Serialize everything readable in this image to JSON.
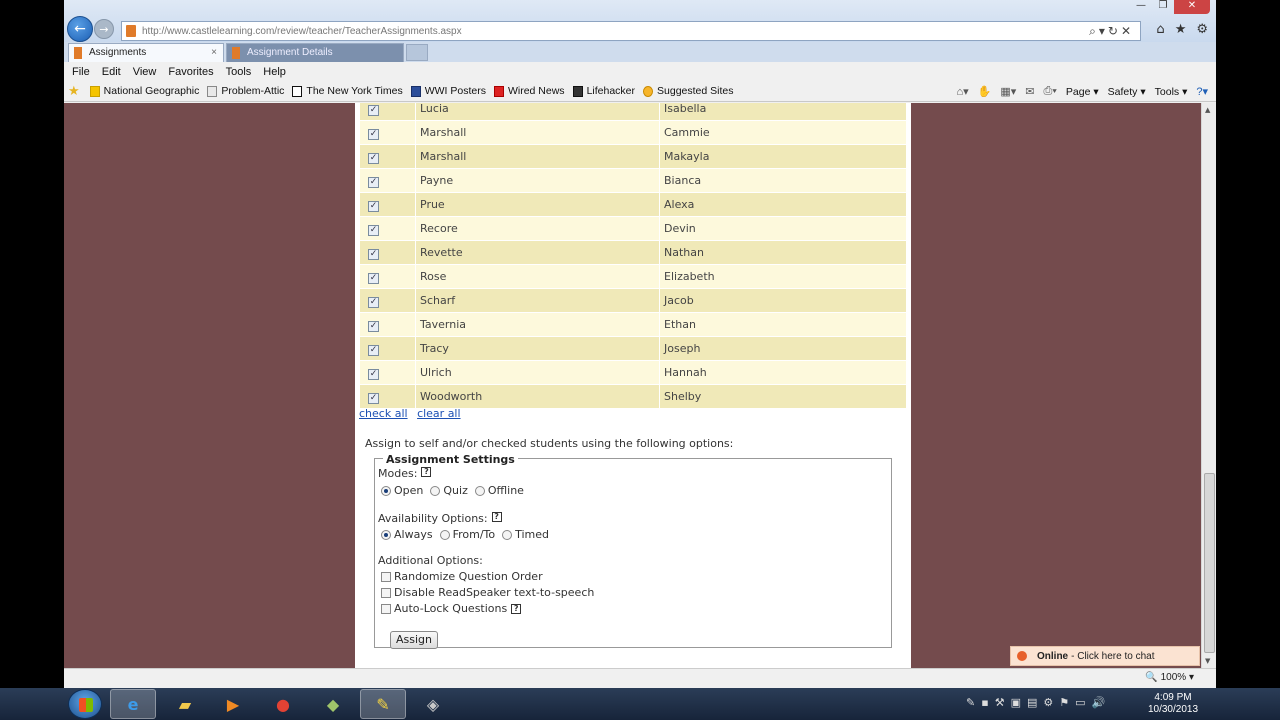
{
  "browser": {
    "url": "http://www.castlelearning.com/review/teacher/TeacherAssignments.aspx",
    "tabs": [
      {
        "label": "Assignments"
      },
      {
        "label": "Assignment Details"
      }
    ],
    "menu": [
      "File",
      "Edit",
      "View",
      "Favorites",
      "Tools",
      "Help"
    ],
    "favorites": [
      "National Geographic",
      "Problem-Attic",
      "The New York Times",
      "WWI Posters",
      "Wired News",
      "Lifehacker",
      "Suggested Sites"
    ],
    "commands": [
      "Page",
      "Safety",
      "Tools"
    ],
    "zoom": "100%"
  },
  "roster": {
    "rows": [
      {
        "last": "Lucia",
        "first": "Isabella",
        "checked": true
      },
      {
        "last": "Marshall",
        "first": "Cammie",
        "checked": true
      },
      {
        "last": "Marshall",
        "first": "Makayla",
        "checked": true
      },
      {
        "last": "Payne",
        "first": "Bianca",
        "checked": true
      },
      {
        "last": "Prue",
        "first": "Alexa",
        "checked": true
      },
      {
        "last": "Recore",
        "first": "Devin",
        "checked": true
      },
      {
        "last": "Revette",
        "first": "Nathan",
        "checked": true
      },
      {
        "last": "Rose",
        "first": "Elizabeth",
        "checked": true
      },
      {
        "last": "Scharf",
        "first": "Jacob",
        "checked": true
      },
      {
        "last": "Tavernia",
        "first": "Ethan",
        "checked": true
      },
      {
        "last": "Tracy",
        "first": "Joseph",
        "checked": true
      },
      {
        "last": "Ulrich",
        "first": "Hannah",
        "checked": true
      },
      {
        "last": "Woodworth",
        "first": "Shelby",
        "checked": true
      }
    ],
    "check_all": "check all",
    "clear_all": "clear all"
  },
  "assign": {
    "intro": "Assign to self and/or checked students using the following options:",
    "legend": "Assignment Settings",
    "modes_label": "Modes:",
    "modes": [
      "Open",
      "Quiz",
      "Offline"
    ],
    "modes_selected": "Open",
    "availability_label": "Availability Options:",
    "availability": [
      "Always",
      "From/To",
      "Timed"
    ],
    "availability_selected": "Always",
    "additional_label": "Additional Options:",
    "additional": [
      "Randomize Question Order",
      "Disable ReadSpeaker text-to-speech",
      "Auto-Lock Questions"
    ],
    "button": "Assign"
  },
  "chat": {
    "status": "Online",
    "text": "- Click here to chat"
  },
  "taskbar": {
    "time": "4:09 PM",
    "date": "10/30/2013"
  }
}
